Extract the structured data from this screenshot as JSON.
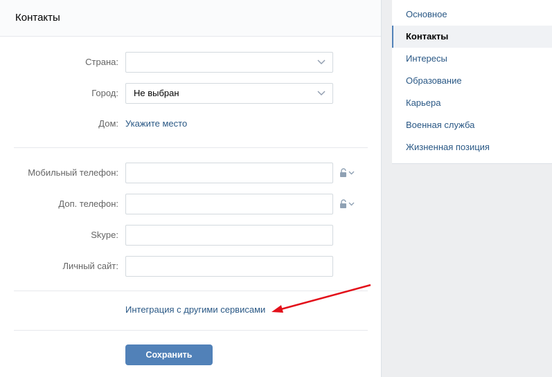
{
  "page": {
    "title": "Контакты"
  },
  "form": {
    "country": {
      "label": "Страна:",
      "value": ""
    },
    "city": {
      "label": "Город:",
      "value": "Не выбран"
    },
    "home": {
      "label": "Дом:",
      "link": "Укажите место"
    },
    "mobile": {
      "label": "Мобильный телефон:",
      "value": ""
    },
    "extra_phone": {
      "label": "Доп. телефон:",
      "value": ""
    },
    "skype": {
      "label": "Skype:",
      "value": ""
    },
    "site": {
      "label": "Личный сайт:",
      "value": ""
    },
    "integration_link": "Интеграция с другими сервисами",
    "save_label": "Сохранить"
  },
  "sidebar": {
    "items": [
      {
        "label": "Основное",
        "active": false
      },
      {
        "label": "Контакты",
        "active": true
      },
      {
        "label": "Интересы",
        "active": false
      },
      {
        "label": "Образование",
        "active": false
      },
      {
        "label": "Карьера",
        "active": false
      },
      {
        "label": "Военная служба",
        "active": false
      },
      {
        "label": "Жизненная позиция",
        "active": false
      }
    ]
  },
  "colors": {
    "accent": "#5181b8",
    "link": "#2a5885",
    "annotation_arrow": "#e3101a"
  },
  "icons": {
    "dropdown": "chevron-down-icon",
    "privacy": "lock-icon"
  }
}
